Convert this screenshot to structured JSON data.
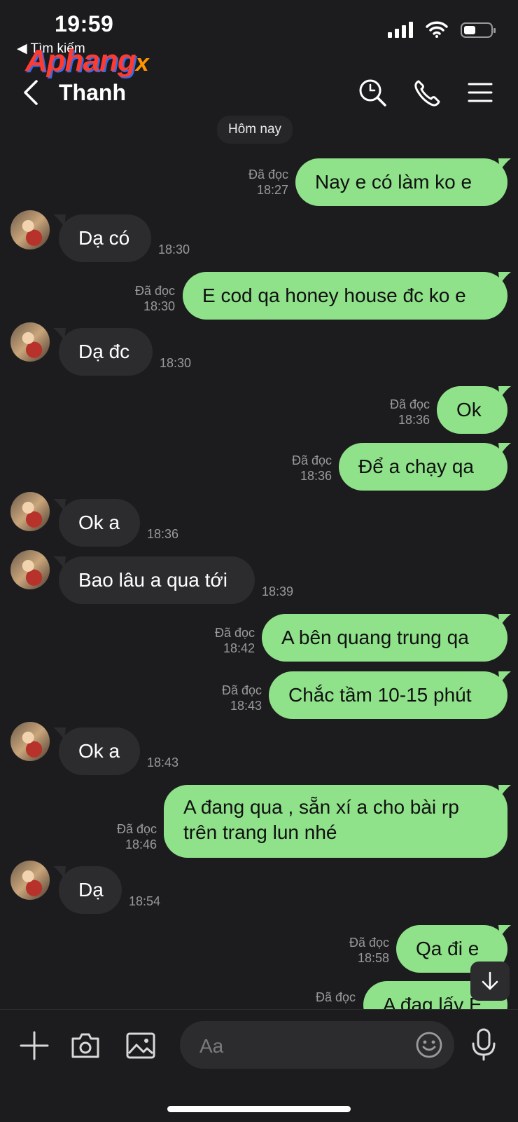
{
  "status_bar": {
    "time": "19:59",
    "back_label": "◀ Tìm kiếm"
  },
  "watermark": {
    "text": "Aphang",
    "suffix": "x"
  },
  "header": {
    "title": "Thanh"
  },
  "date_chip": "Hôm nay",
  "messages": [
    {
      "dir": "out",
      "text": "Nay e có làm ko e",
      "status": "Đã đọc",
      "time": "18:27"
    },
    {
      "dir": "in",
      "text": "Dạ có",
      "time": "18:30"
    },
    {
      "dir": "out",
      "text": "E cod qa honey house đc ko e",
      "status": "Đã đọc",
      "time": "18:30"
    },
    {
      "dir": "in",
      "text": "Dạ đc",
      "time": "18:30"
    },
    {
      "dir": "out",
      "text": "Ok",
      "status": "Đã đọc",
      "time": "18:36"
    },
    {
      "dir": "out",
      "text": "Để a chạy qa",
      "status": "Đã đọc",
      "time": "18:36"
    },
    {
      "dir": "in",
      "text": "Ok a",
      "time": "18:36"
    },
    {
      "dir": "in",
      "text": "Bao lâu a qua tới",
      "time": "18:39"
    },
    {
      "dir": "out",
      "text": "A bên quang trung qa",
      "status": "Đã đọc",
      "time": "18:42"
    },
    {
      "dir": "out",
      "text": "Chắc tầm 10-15 phút",
      "status": "Đã đọc",
      "time": "18:43"
    },
    {
      "dir": "in",
      "text": "Ok a",
      "time": "18:43"
    },
    {
      "dir": "out",
      "text": "A đang qua , sẵn xí a cho bài rp trên trang lun nhé",
      "status": "Đã đọc",
      "time": "18:46"
    },
    {
      "dir": "in",
      "text": "Dạ",
      "time": "18:54"
    },
    {
      "dir": "out",
      "text": "Qa đi e",
      "status": "Đã đọc",
      "time": "18:58"
    },
    {
      "dir": "out",
      "text": "A đag lấy E",
      "status": "Đã đọc",
      "time": ""
    }
  ],
  "composer": {
    "placeholder": "Aa"
  },
  "icons": {
    "header": [
      "back-icon",
      "search-icon",
      "phone-icon",
      "menu-icon"
    ],
    "composer": [
      "plus-icon",
      "camera-icon",
      "image-icon",
      "emoji-icon",
      "microphone-icon"
    ],
    "scroll": "arrow-down-icon"
  },
  "colors": {
    "background": "#1c1c1e",
    "outgoing_bubble": "#8fe28a",
    "incoming_bubble": "#2c2c2e",
    "meta_text": "#9a9a9a"
  }
}
